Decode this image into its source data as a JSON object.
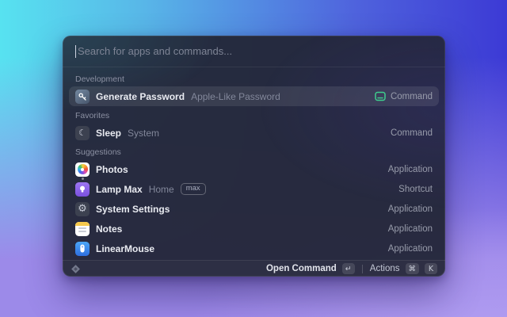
{
  "search": {
    "placeholder": "Search for apps and commands..."
  },
  "sections": [
    {
      "title": "Development",
      "items": [
        {
          "icon": "key-icon",
          "title": "Generate Password",
          "subtitle": "Apple-Like Password",
          "accessory_icon": "command-keycap-icon",
          "accessory": "Command",
          "selected": true
        }
      ]
    },
    {
      "title": "Favorites",
      "items": [
        {
          "icon": "moon-icon",
          "title": "Sleep",
          "subtitle": "System",
          "accessory": "Command"
        }
      ]
    },
    {
      "title": "Suggestions",
      "items": [
        {
          "icon": "photos-pinwheel-icon",
          "title": "Photos",
          "accessory": "Application",
          "running": true
        },
        {
          "icon": "lamp-icon",
          "title": "Lamp Max",
          "subtitle": "Home",
          "badge": "max",
          "accessory": "Shortcut"
        },
        {
          "icon": "gear-icon",
          "title": "System Settings",
          "accessory": "Application"
        },
        {
          "icon": "notes-icon",
          "title": "Notes",
          "accessory": "Application",
          "running": true
        },
        {
          "icon": "mouse-icon",
          "title": "LinearMouse",
          "accessory": "Application"
        }
      ]
    }
  ],
  "footer": {
    "open_label": "Open Command",
    "enter_key": "↵",
    "actions_label": "Actions",
    "cmd_key": "⌘",
    "k_key": "K"
  },
  "icons": {
    "moon_glyph": "☾",
    "gear_glyph": "⚙",
    "accent_green": "#3ecf8e"
  }
}
